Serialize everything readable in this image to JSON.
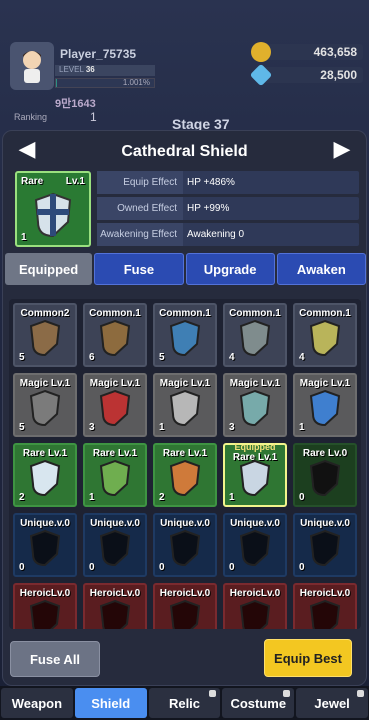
{
  "player": {
    "name": "Player_75735",
    "level_label": "LEVEL",
    "level": "36",
    "xp": "1.001%",
    "xp_fraction": 0.01,
    "power": "9만1643",
    "ranking_label": "Ranking",
    "ranking": "1",
    "stage": "Stage 37"
  },
  "currency": {
    "gold": "463,658",
    "gems": "28,500"
  },
  "item": {
    "name": "Cathedral Shield",
    "tier": "Rare",
    "level": "Lv.1",
    "count": "1"
  },
  "stats": [
    {
      "label": "Equip Effect",
      "value": "HP +486%"
    },
    {
      "label": "Owned Effect",
      "value": "HP +99%"
    },
    {
      "label": "Awakening Effect",
      "value": "Awakening 0"
    }
  ],
  "tabs": [
    "Equipped",
    "Fuse",
    "Upgrade",
    "Awaken"
  ],
  "grid": [
    [
      {
        "tier": "Common2",
        "count": "5",
        "cls": "common",
        "color": "#8b6b47"
      },
      {
        "tier": "Common.1",
        "count": "6",
        "cls": "common",
        "color": "#8d6b3e"
      },
      {
        "tier": "Common.1",
        "count": "5",
        "cls": "common",
        "color": "#3f7fb4"
      },
      {
        "tier": "Common.1",
        "count": "4",
        "cls": "common",
        "color": "#7f8c8d"
      },
      {
        "tier": "Common.1",
        "count": "4",
        "cls": "common",
        "color": "#b9b45a"
      }
    ],
    [
      {
        "tier": "Magic Lv.1",
        "count": "5",
        "cls": "magic",
        "color": "#7b7b7b"
      },
      {
        "tier": "Magic Lv.1",
        "count": "3",
        "cls": "magic",
        "color": "#b33"
      },
      {
        "tier": "Magic Lv.1",
        "count": "1",
        "cls": "magic",
        "color": "#b7b7b7"
      },
      {
        "tier": "Magic Lv.1",
        "count": "3",
        "cls": "magic",
        "color": "#7aa"
      },
      {
        "tier": "Magic Lv.1",
        "count": "1",
        "cls": "magic",
        "color": "#3f7fcf"
      }
    ],
    [
      {
        "tier": "Rare Lv.1",
        "count": "2",
        "cls": "rare",
        "color": "#d8e6ef"
      },
      {
        "tier": "Rare Lv.1",
        "count": "1",
        "cls": "rare",
        "color": "#6fae4f"
      },
      {
        "tier": "Rare Lv.1",
        "count": "2",
        "cls": "rare",
        "color": "#cf7a3a"
      },
      {
        "tier": "Rare Lv.1",
        "count": "1",
        "cls": "rare sel",
        "color": "#c9d6e3",
        "equipped": "Equipped"
      },
      {
        "tier": "Rare Lv.0",
        "count": "0",
        "cls": "rare dim",
        "color": "#111"
      }
    ],
    [
      {
        "tier": "Unique.v.0",
        "count": "0",
        "cls": "unique",
        "color": "#0a0f18"
      },
      {
        "tier": "Unique.v.0",
        "count": "0",
        "cls": "unique",
        "color": "#0a0f18"
      },
      {
        "tier": "Unique.v.0",
        "count": "0",
        "cls": "unique",
        "color": "#0a0f18"
      },
      {
        "tier": "Unique.v.0",
        "count": "0",
        "cls": "unique",
        "color": "#0a0f18"
      },
      {
        "tier": "Unique.v.0",
        "count": "0",
        "cls": "unique",
        "color": "#0a0f18"
      }
    ],
    [
      {
        "tier": "HeroicLv.0",
        "count": "",
        "cls": "heroic",
        "color": "#240607"
      },
      {
        "tier": "HeroicLv.0",
        "count": "",
        "cls": "heroic",
        "color": "#240607"
      },
      {
        "tier": "HeroicLv.0",
        "count": "",
        "cls": "heroic",
        "color": "#240607"
      },
      {
        "tier": "HeroicLv.0",
        "count": "",
        "cls": "heroic",
        "color": "#240607"
      },
      {
        "tier": "HeroicLv.0",
        "count": "",
        "cls": "heroic",
        "color": "#240607"
      }
    ]
  ],
  "buttons": {
    "fuse_all": "Fuse All",
    "equip_best": "Equip Best"
  },
  "nav": [
    {
      "label": "Weapon",
      "active": false,
      "locked": false
    },
    {
      "label": "Shield",
      "active": true,
      "locked": false
    },
    {
      "label": "Relic",
      "active": false,
      "locked": true
    },
    {
      "label": "Costume",
      "active": false,
      "locked": true
    },
    {
      "label": "Jewel",
      "active": false,
      "locked": true
    }
  ]
}
